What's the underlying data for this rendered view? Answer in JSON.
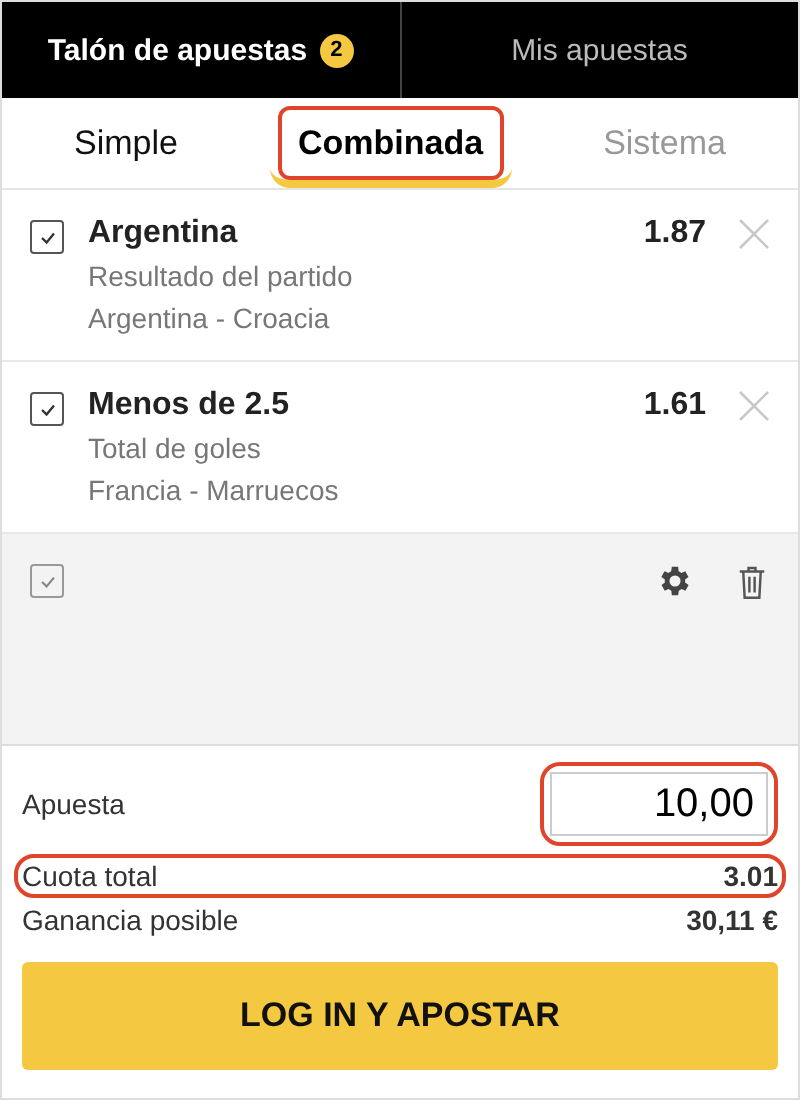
{
  "header_tabs": [
    {
      "label": "Talón de apuestas",
      "badge": "2",
      "selected": true
    },
    {
      "label": "Mis apuestas",
      "selected": false
    }
  ],
  "bet_types": [
    {
      "label": "Simple",
      "selected": false,
      "highlighted": false
    },
    {
      "label": "Combinada",
      "selected": true,
      "highlighted": true
    },
    {
      "label": "Sistema",
      "selected": false,
      "highlighted": false
    }
  ],
  "selections": [
    {
      "checked": true,
      "pick": "Argentina",
      "market": "Resultado del partido",
      "match": "Argentina - Croacia",
      "odds": "1.87"
    },
    {
      "checked": true,
      "pick": "Menos de 2.5",
      "market": "Total de goles",
      "match": "Francia - Marruecos",
      "odds": "1.61"
    }
  ],
  "toolbar": {
    "select_all_checked": true
  },
  "stake": {
    "label": "Apuesta",
    "value": "10,00",
    "highlighted": true
  },
  "summary": [
    {
      "label": "Cuota total",
      "value": "3.01",
      "highlighted": true
    },
    {
      "label": "Ganancia posible",
      "value": "30,11 €",
      "highlighted": false
    }
  ],
  "submit_button": "LOG IN Y APOSTAR"
}
